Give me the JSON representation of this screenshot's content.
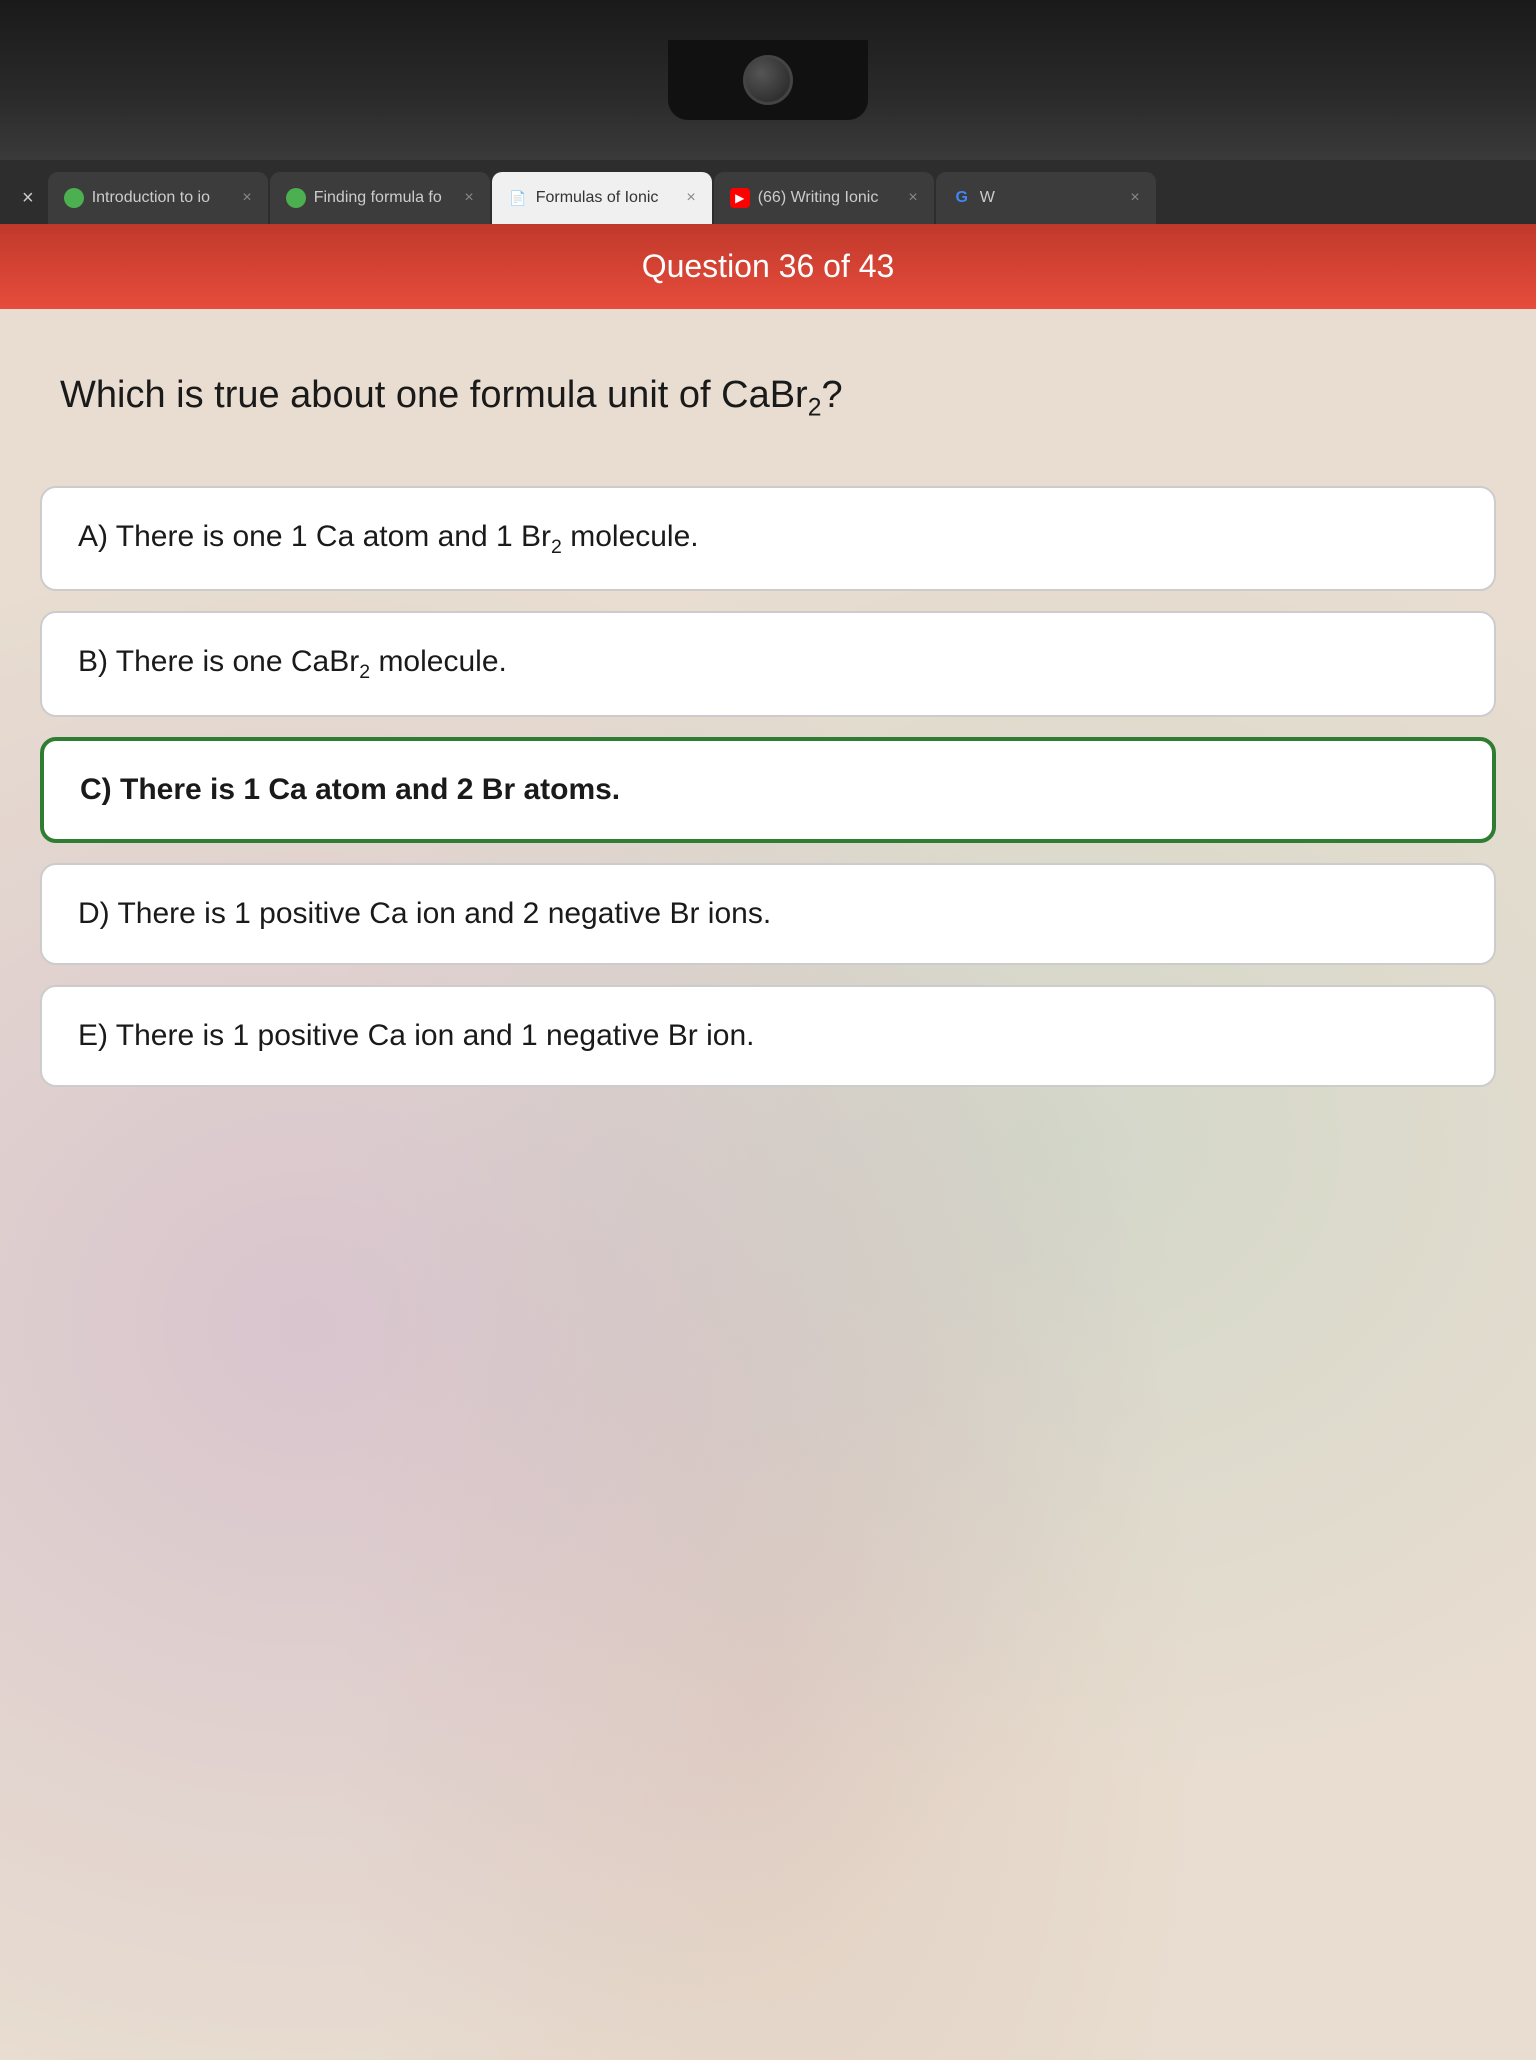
{
  "browser": {
    "tabs": [
      {
        "id": "tab1",
        "label": "Introduction to io",
        "favicon_type": "green-circle",
        "active": false
      },
      {
        "id": "tab2",
        "label": "Finding formula fo",
        "favicon_type": "green-circle",
        "active": false
      },
      {
        "id": "tab3",
        "label": "Formulas of Ionic",
        "favicon_type": "doc-icon",
        "active": true
      },
      {
        "id": "tab4",
        "label": "(66) Writing Ionic",
        "favicon_type": "youtube-red",
        "active": false
      },
      {
        "id": "tab5",
        "label": "W",
        "favicon_type": "google-g",
        "active": false
      }
    ],
    "close_label": "×"
  },
  "question": {
    "number": "Question 36 of 43",
    "text_part1": "Which is true about one formula unit of CaBr",
    "text_subscript": "2",
    "text_part2": "?"
  },
  "answers": [
    {
      "id": "A",
      "label": "A) There is one 1 Ca atom and 1 Br",
      "sub": "2",
      "label_end": " molecule.",
      "selected": false,
      "correct": false
    },
    {
      "id": "B",
      "label": "B) There is one CaBr",
      "sub": "2",
      "label_end": " molecule.",
      "selected": false,
      "correct": false
    },
    {
      "id": "C",
      "label": "C) There is 1 Ca atom and 2 Br atoms.",
      "sub": "",
      "label_end": "",
      "selected": true,
      "correct": true
    },
    {
      "id": "D",
      "label": "D) There is 1 positive Ca ion and 2 negative Br ions.",
      "sub": "",
      "label_end": "",
      "selected": false,
      "correct": false
    },
    {
      "id": "E",
      "label": "E) There is 1 positive Ca ion and 1 negative Br ion.",
      "sub": "",
      "label_end": "",
      "selected": false,
      "correct": false
    }
  ]
}
